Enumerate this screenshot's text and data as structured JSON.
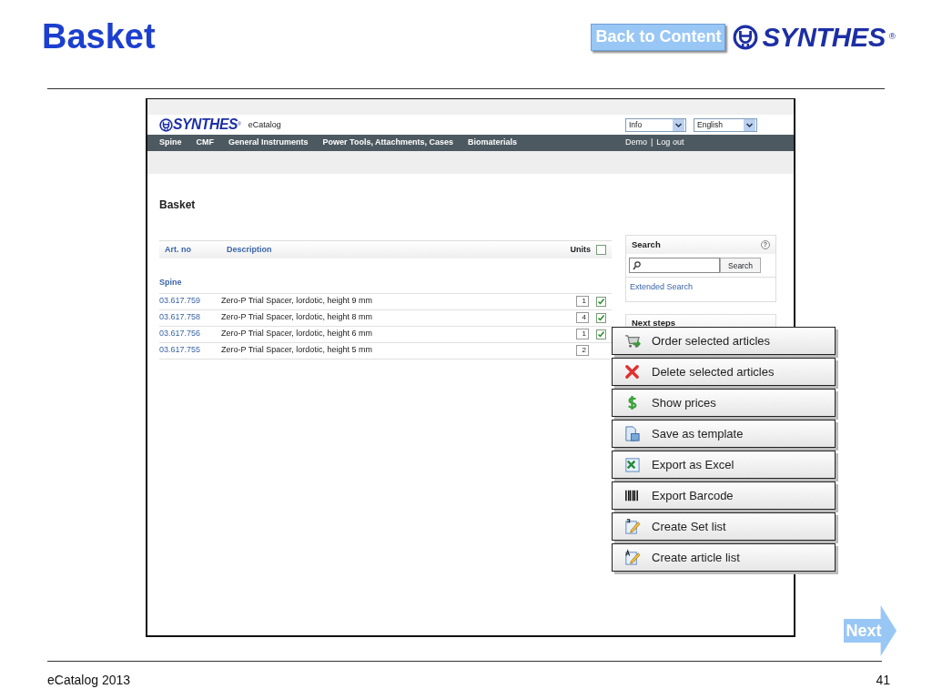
{
  "slide": {
    "title": "Basket",
    "back_button": "Back to Content",
    "logo": {
      "text": "SYNTHES",
      "mark": "®"
    },
    "next_button": "Next",
    "footer_left": "eCatalog 2013",
    "page_number": "41"
  },
  "app": {
    "logo": {
      "text": "SYNTHES",
      "mark": "®"
    },
    "app_name": "eCatalog",
    "selects": [
      {
        "value": "Info"
      },
      {
        "value": "English"
      }
    ],
    "nav": [
      "Spine",
      "CMF",
      "General Instruments",
      "Power Tools, Attachments, Cases",
      "Biomaterials"
    ],
    "user_links": {
      "first": "Demo",
      "separator": "|",
      "second": "Log out"
    },
    "heading": "Basket",
    "table": {
      "columns": [
        "Art. no",
        "Description",
        "Units"
      ],
      "select_all_checked": false,
      "group": "Spine",
      "rows": [
        {
          "art_no": "03.617.759",
          "description": "Zero-P Trial Spacer, lordotic, height 9 mm",
          "units": "1",
          "checked": true
        },
        {
          "art_no": "03.617.758",
          "description": "Zero-P Trial Spacer, lordotic, height 8 mm",
          "units": "4",
          "checked": true
        },
        {
          "art_no": "03.617.756",
          "description": "Zero-P Trial Spacer, lordotic, height 6 mm",
          "units": "1",
          "checked": true
        },
        {
          "art_no": "03.617.755",
          "description": "Zero-P Trial Spacer, lordotic, height 5 mm",
          "units": "2"
        }
      ]
    },
    "search": {
      "title": "Search",
      "help": "?",
      "button": "Search",
      "link": "Extended Search"
    },
    "next_steps": {
      "title": "Next steps"
    },
    "menu": [
      {
        "kind": "cart",
        "label": "Order selected articles"
      },
      {
        "kind": "delete",
        "label": "Delete selected articles"
      },
      {
        "kind": "price",
        "label": "Show prices"
      },
      {
        "kind": "template",
        "label": "Save as template"
      },
      {
        "kind": "excel",
        "label": "Export as Excel"
      },
      {
        "kind": "barcode",
        "label": "Export Barcode"
      },
      {
        "kind": "setlist",
        "label": "Create Set list"
      },
      {
        "kind": "articlelist",
        "label": "Create article list"
      }
    ]
  }
}
